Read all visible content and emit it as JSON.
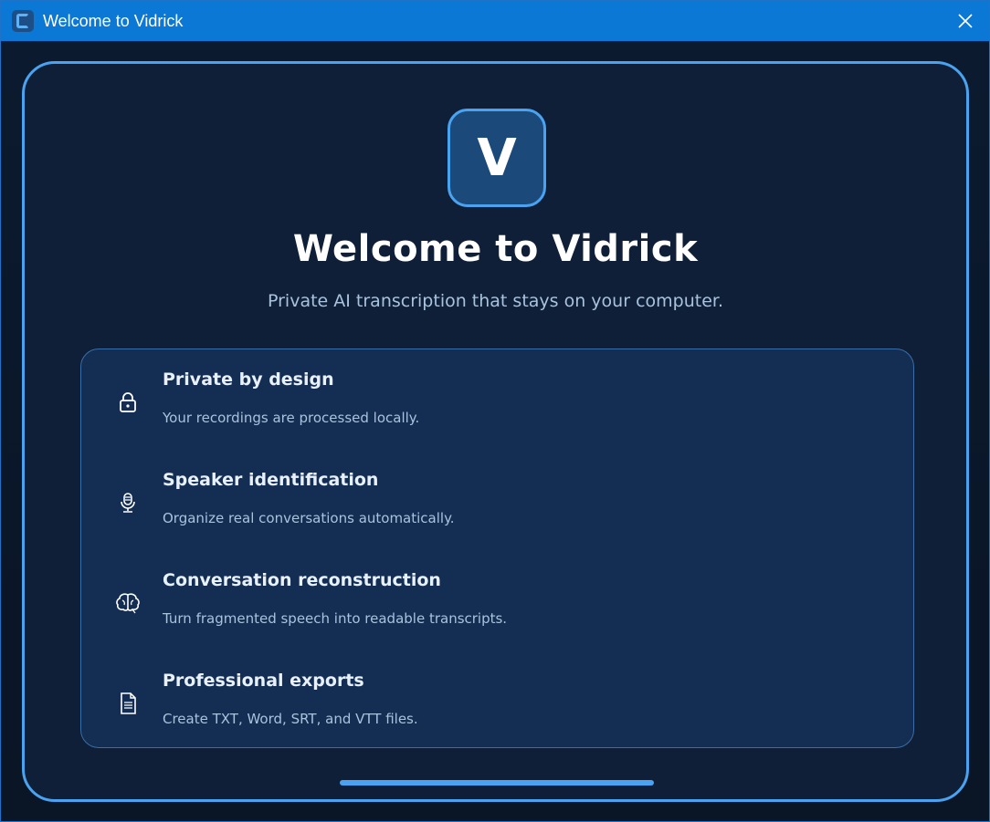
{
  "window": {
    "title": "Welcome to Vidrick",
    "title_bar_color": "#0a78d4"
  },
  "logo": {
    "letter": "V"
  },
  "main": {
    "heading": "Welcome to Vidrick",
    "subheading": "Private AI transcription that stays on your computer."
  },
  "features": [
    {
      "icon": "lock-icon",
      "title": "Private by design",
      "description": "Your recordings are processed locally."
    },
    {
      "icon": "microphone-icon",
      "title": "Speaker identification",
      "description": "Organize real conversations automatically."
    },
    {
      "icon": "brain-icon",
      "title": "Conversation reconstruction",
      "description": "Turn fragmented speech into readable transcripts."
    },
    {
      "icon": "document-icon",
      "title": "Professional exports",
      "description": "Create TXT, Word, SRT, and VTT files."
    }
  ],
  "colors": {
    "accent": "#4aa3f0",
    "panel_bg": "#0e1f37",
    "card_bg": "#132e52"
  }
}
